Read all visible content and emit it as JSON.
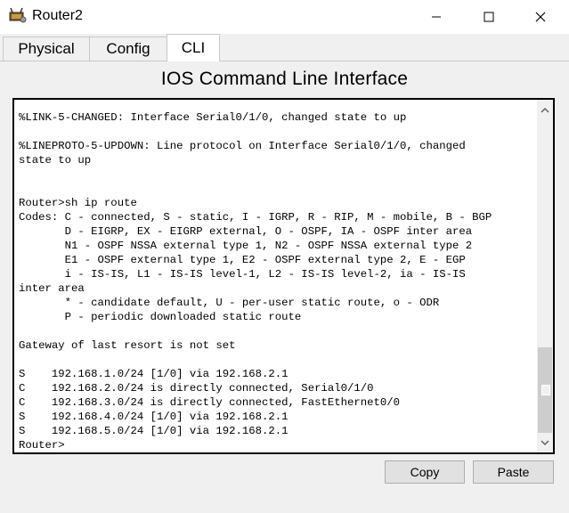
{
  "window": {
    "title": "Router2",
    "app_icon": "router-icon",
    "controls": [
      "minimize-icon",
      "maximize-icon",
      "close-icon"
    ]
  },
  "tabs": [
    {
      "label": "Physical",
      "active": false
    },
    {
      "label": "Config",
      "active": false
    },
    {
      "label": "CLI",
      "active": true
    }
  ],
  "panel": {
    "title": "IOS Command Line Interface"
  },
  "terminal": {
    "output": "%LINK-5-CHANGED: Interface Serial0/1/0, changed state to up\n\n%LINEPROTO-5-UPDOWN: Line protocol on Interface Serial0/1/0, changed\nstate to up\n\n\nRouter>sh ip route\nCodes: C - connected, S - static, I - IGRP, R - RIP, M - mobile, B - BGP\n       D - EIGRP, EX - EIGRP external, O - OSPF, IA - OSPF inter area\n       N1 - OSPF NSSA external type 1, N2 - OSPF NSSA external type 2\n       E1 - OSPF external type 1, E2 - OSPF external type 2, E - EGP\n       i - IS-IS, L1 - IS-IS level-1, L2 - IS-IS level-2, ia - IS-IS\ninter area\n       * - candidate default, U - per-user static route, o - ODR\n       P - periodic downloaded static route\n\nGateway of last resort is not set\n\nS    192.168.1.0/24 [1/0] via 192.168.2.1\nC    192.168.2.0/24 is directly connected, Serial0/1/0\nC    192.168.3.0/24 is directly connected, FastEthernet0/0\nS    192.168.4.0/24 [1/0] via 192.168.2.1\nS    192.168.5.0/24 [1/0] via 192.168.2.1\nRouter>"
  },
  "buttons": {
    "copy": "Copy",
    "paste": "Paste"
  }
}
